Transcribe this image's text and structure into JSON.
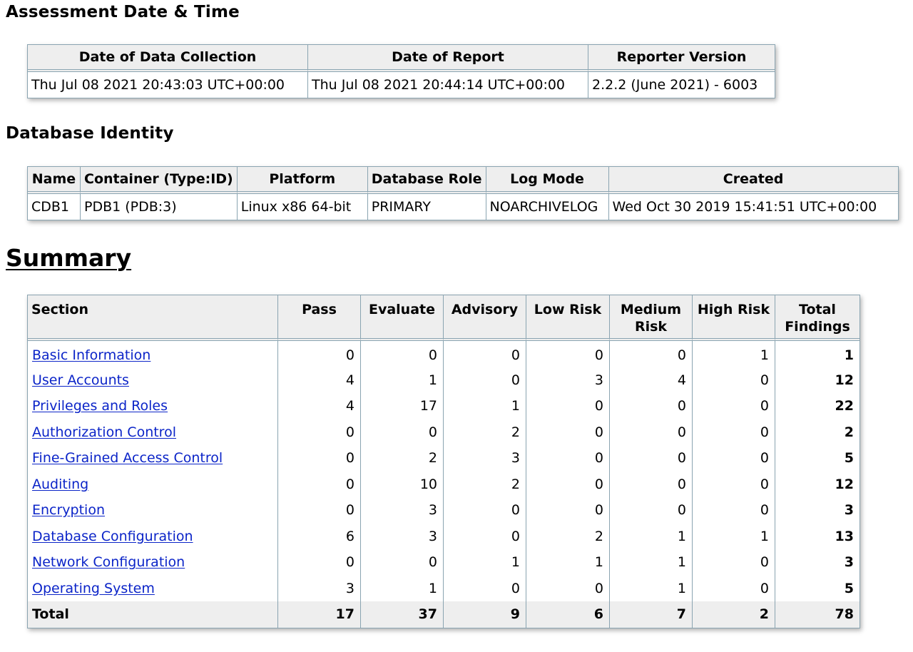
{
  "assessment": {
    "heading": "Assessment Date & Time",
    "headers": [
      "Date of Data Collection",
      "Date of Report",
      "Reporter Version"
    ],
    "row": [
      "Thu Jul 08 2021 20:43:03 UTC+00:00",
      "Thu Jul 08 2021 20:44:14 UTC+00:00",
      "2.2.2 (June 2021) - 6003"
    ]
  },
  "identity": {
    "heading": "Database Identity",
    "headers": [
      "Name",
      "Container (Type:ID)",
      "Platform",
      "Database Role",
      "Log Mode",
      "Created"
    ],
    "row": [
      "CDB1",
      "PDB1 (PDB:3)",
      "Linux x86 64-bit",
      "PRIMARY",
      "NOARCHIVELOG",
      "Wed Oct 30 2019 15:41:51 UTC+00:00"
    ]
  },
  "summary": {
    "heading": "Summary",
    "headers": [
      "Section",
      "Pass",
      "Evaluate",
      "Advisory",
      "Low Risk",
      "Medium Risk",
      "High Risk",
      "Total Findings"
    ],
    "rows": [
      {
        "section": "Basic Information",
        "values": [
          "0",
          "0",
          "0",
          "0",
          "0",
          "1",
          "1"
        ]
      },
      {
        "section": "User Accounts",
        "values": [
          "4",
          "1",
          "0",
          "3",
          "4",
          "0",
          "12"
        ]
      },
      {
        "section": "Privileges and Roles",
        "values": [
          "4",
          "17",
          "1",
          "0",
          "0",
          "0",
          "22"
        ]
      },
      {
        "section": "Authorization Control",
        "values": [
          "0",
          "0",
          "2",
          "0",
          "0",
          "0",
          "2"
        ]
      },
      {
        "section": "Fine-Grained Access Control",
        "values": [
          "0",
          "2",
          "3",
          "0",
          "0",
          "0",
          "5"
        ]
      },
      {
        "section": "Auditing",
        "values": [
          "0",
          "10",
          "2",
          "0",
          "0",
          "0",
          "12"
        ]
      },
      {
        "section": "Encryption",
        "values": [
          "0",
          "3",
          "0",
          "0",
          "0",
          "0",
          "3"
        ]
      },
      {
        "section": "Database Configuration",
        "values": [
          "6",
          "3",
          "0",
          "2",
          "1",
          "1",
          "13"
        ]
      },
      {
        "section": "Network Configuration",
        "values": [
          "0",
          "0",
          "1",
          "1",
          "1",
          "0",
          "3"
        ]
      },
      {
        "section": "Operating System",
        "values": [
          "3",
          "1",
          "0",
          "0",
          "1",
          "0",
          "5"
        ]
      }
    ],
    "total": {
      "label": "Total",
      "values": [
        "17",
        "37",
        "9",
        "6",
        "7",
        "2",
        "78"
      ]
    }
  },
  "colors": {
    "link": "#0b24c8",
    "border": "#8aa4b1",
    "header_bg": "#eeeeee"
  }
}
